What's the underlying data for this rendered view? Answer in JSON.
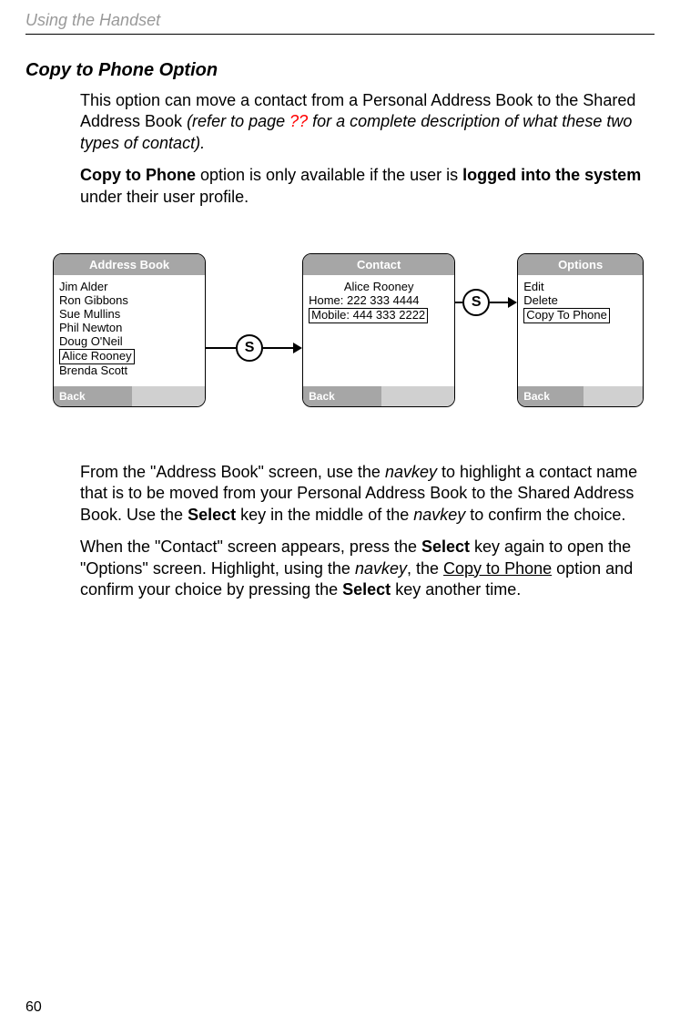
{
  "page": {
    "header": "Using the Handset",
    "number": "60"
  },
  "section_title": "Copy to Phone Option",
  "intro": {
    "p1a": "This option can move a contact from a Personal Address Book to the Shared Address Book ",
    "p1b": "(refer to page ",
    "p1c": "??",
    "p1d": " for a complete description of what these two types of contact).",
    "p2a": "Copy to Phone",
    "p2b": " option is only available if the user is ",
    "p2c": "logged into the system",
    "p2d": " under their user profile."
  },
  "screens": {
    "address_book": {
      "title": "Address Book",
      "items": [
        "Jim Alder",
        "Ron Gibbons",
        "Sue Mullins",
        "Phil Newton",
        "Doug O'Neil",
        "Alice Rooney",
        "Brenda Scott"
      ],
      "highlighted": "Alice Rooney",
      "back": "Back"
    },
    "contact": {
      "title": "Contact",
      "name": "Alice Rooney",
      "home": "Home: 222 333 4444",
      "mobile": "Mobile: 444 333 2222",
      "back": "Back"
    },
    "options": {
      "title": "Options",
      "items": [
        "Edit",
        "Delete",
        "Copy To Phone"
      ],
      "highlighted": "Copy To Phone",
      "back": "Back"
    },
    "select_key": "S"
  },
  "footer_text": {
    "p1a": "From the \"Address Book\" screen, use the ",
    "p1b": "navkey",
    "p1c": " to highlight a contact name that is to be moved from your Personal Address Book to the Shared Address Book. Use the ",
    "p1d": "Select",
    "p1e": " key in the middle of the ",
    "p1f": "navkey",
    "p1g": " to confirm the choice.",
    "p2a": "When the \"Contact\" screen appears, press the ",
    "p2b": "Select",
    "p2c": " key again to open the \"Options\" screen. Highlight, using the ",
    "p2d": "navkey",
    "p2e": ", the ",
    "p2f": "Copy to Phone",
    "p2g": " option and confirm your choice by pressing the ",
    "p2h": "Select",
    "p2i": " key another time."
  }
}
